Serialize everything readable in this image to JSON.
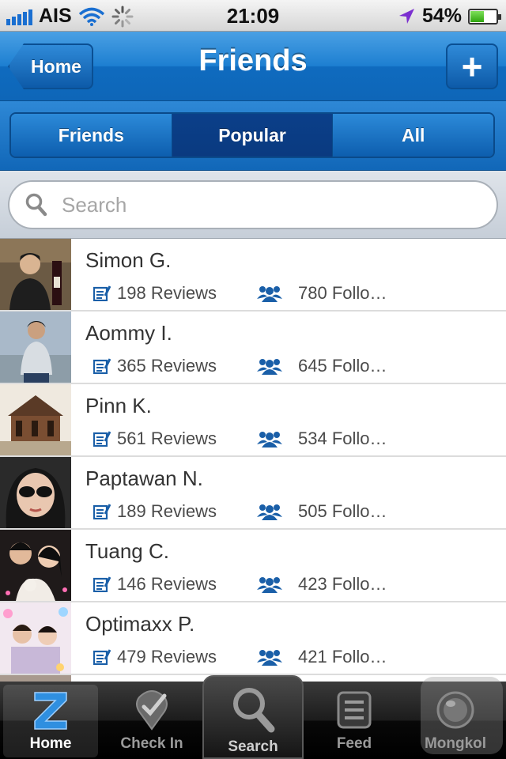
{
  "status_bar": {
    "carrier": "AIS",
    "time": "21:09",
    "battery_percent": "54%",
    "battery_level": 0.54
  },
  "nav": {
    "back_label": "Home",
    "title": "Friends",
    "add_label": "+"
  },
  "segments": {
    "items": [
      {
        "label": "Friends"
      },
      {
        "label": "Popular"
      },
      {
        "label": "All"
      }
    ],
    "selected": "Popular"
  },
  "search": {
    "placeholder": "Search"
  },
  "people": [
    {
      "name": "Simon G.",
      "reviews": "198 Reviews",
      "followers": "780 Follo…"
    },
    {
      "name": "Aommy I.",
      "reviews": "365 Reviews",
      "followers": "645 Follo…"
    },
    {
      "name": "Pinn K.",
      "reviews": "561 Reviews",
      "followers": "534 Follo…"
    },
    {
      "name": "Paptawan N.",
      "reviews": "189 Reviews",
      "followers": "505 Follo…"
    },
    {
      "name": "Tuang C.",
      "reviews": "146 Reviews",
      "followers": "423 Follo…"
    },
    {
      "name": "Optimaxx P.",
      "reviews": "479 Reviews",
      "followers": "421 Follo…"
    }
  ],
  "tabs": [
    {
      "label": "Home",
      "icon": "zocial-z-icon"
    },
    {
      "label": "Check In",
      "icon": "checkin-icon"
    },
    {
      "label": "Search",
      "icon": "magnifier-icon"
    },
    {
      "label": "Feed",
      "icon": "feed-icon"
    },
    {
      "label": "Mongkol",
      "icon": "mongkol-icon"
    }
  ],
  "colors": {
    "nav_blue": "#1d7fd1",
    "segment_selected": "#0a3a80",
    "icon_blue": "#1a5fa8"
  }
}
